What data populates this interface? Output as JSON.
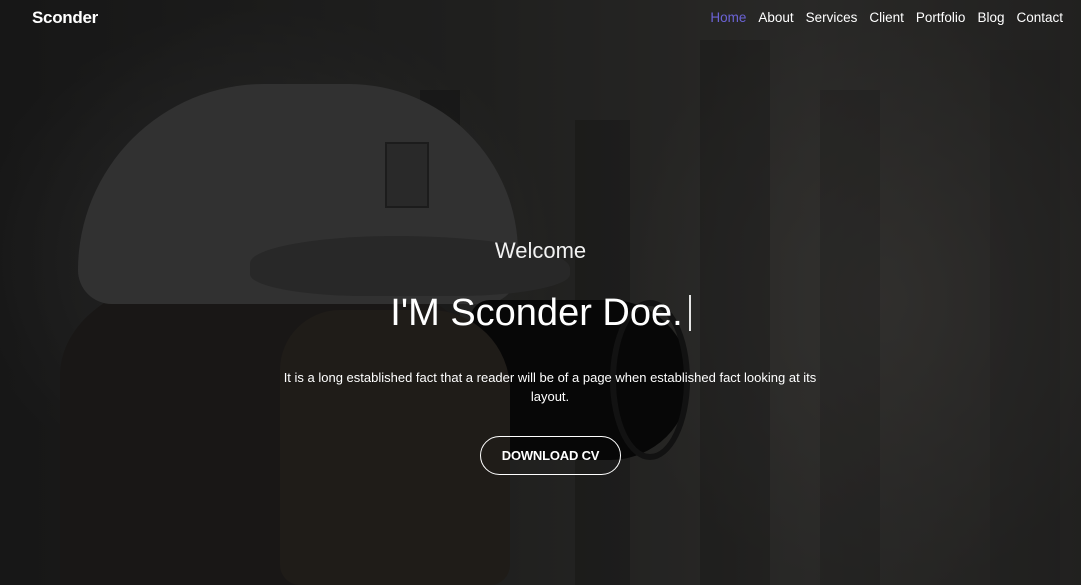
{
  "header": {
    "logo": "Sconder"
  },
  "nav": {
    "items": [
      {
        "label": "Home",
        "active": true
      },
      {
        "label": "About",
        "active": false
      },
      {
        "label": "Services",
        "active": false
      },
      {
        "label": "Client",
        "active": false
      },
      {
        "label": "Portfolio",
        "active": false
      },
      {
        "label": "Blog",
        "active": false
      },
      {
        "label": "Contact",
        "active": false
      }
    ]
  },
  "hero": {
    "welcome": "Welcome",
    "headline": "I'M Sconder Doe.",
    "description": "It is a long established fact that a reader will be of a page when established fact looking at its layout.",
    "cta_label": "DOWNLOAD CV"
  },
  "colors": {
    "accent": "#6b63d6",
    "text": "#ffffff"
  }
}
